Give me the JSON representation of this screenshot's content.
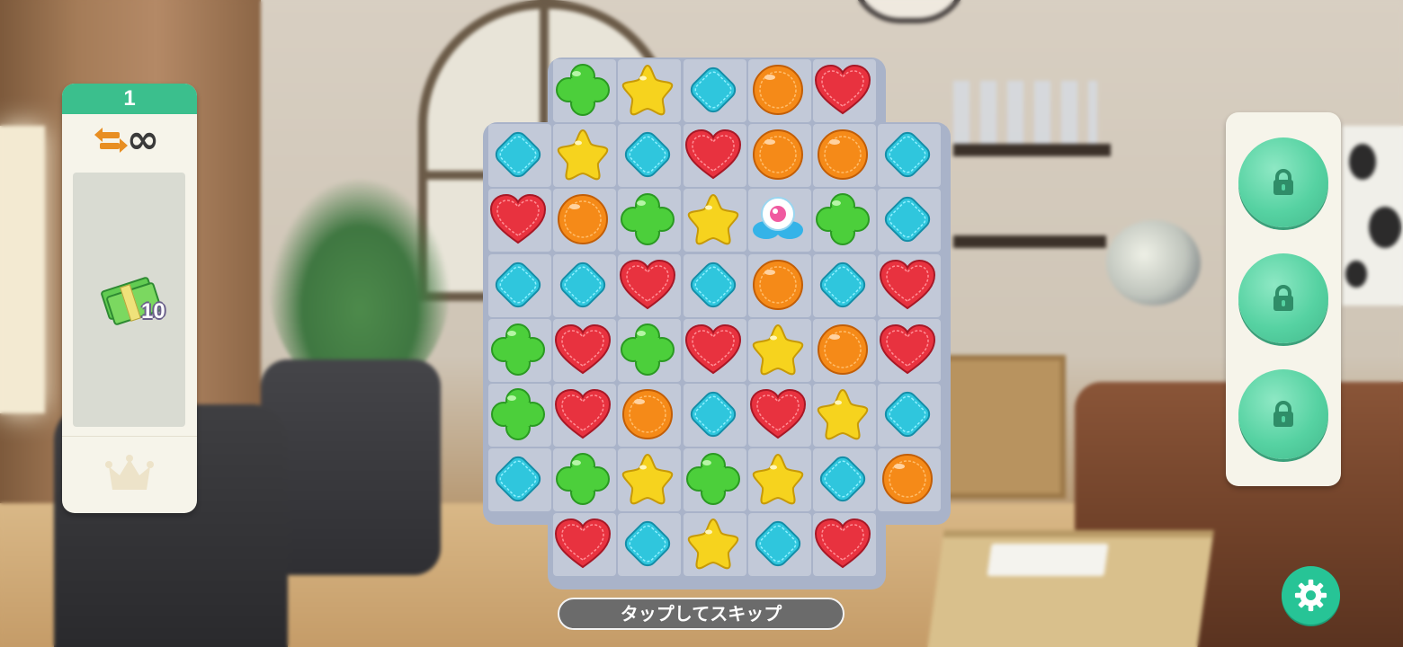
{
  "level_label": "1",
  "moves": "∞",
  "goal": {
    "item": "cash-stack-icon",
    "count": "10"
  },
  "skip_label": "タップしてスキップ",
  "boosters": [
    {
      "state": "locked"
    },
    {
      "state": "locked"
    },
    {
      "state": "locked"
    }
  ],
  "colors": {
    "accent": "#3bbf8d",
    "settings": "#27c496",
    "board": "#a9b3c9",
    "cell": "#c2c9d8",
    "piece_red_heart": "#e8323f",
    "piece_green_clover": "#4ccf3b",
    "piece_yellow_star": "#f6d31e",
    "piece_blue_diamond": "#2fc6dd",
    "piece_orange_circle": "#f58a18"
  },
  "board": {
    "rows": [
      [
        "",
        "G",
        "Y",
        "B",
        "O",
        "R",
        ""
      ],
      [
        "B",
        "Y",
        "B",
        "R",
        "O",
        "O",
        "B"
      ],
      [
        "R",
        "O",
        "G",
        "Y",
        "P",
        "G",
        "B"
      ],
      [
        "B",
        "B",
        "R",
        "B",
        "O",
        "B",
        "R"
      ],
      [
        "G",
        "R",
        "G",
        "R",
        "Y",
        "O",
        "R"
      ],
      [
        "G",
        "R",
        "O",
        "B",
        "R",
        "Y",
        "B"
      ],
      [
        "B",
        "G",
        "Y",
        "G",
        "Y",
        "B",
        "O"
      ],
      [
        "",
        "R",
        "B",
        "Y",
        "B",
        "R",
        ""
      ]
    ],
    "legend": {
      "R": "red-heart",
      "G": "green-clover",
      "Y": "yellow-star",
      "B": "blue-diamond",
      "O": "orange-circle",
      "P": "pink-bomb"
    }
  }
}
